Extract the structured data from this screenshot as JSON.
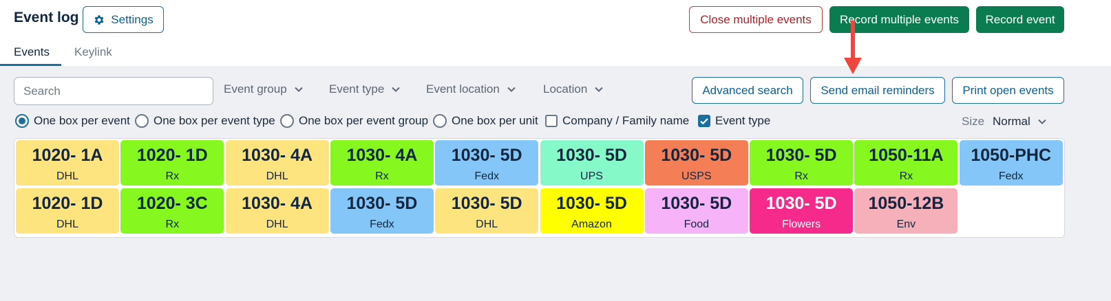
{
  "header": {
    "title": "Event log",
    "settings_label": "Settings",
    "close_multiple_label": "Close multiple events",
    "record_multiple_label": "Record multiple events",
    "record_event_label": "Record event"
  },
  "tabs": [
    {
      "label": "Events",
      "active": true
    },
    {
      "label": "Keylink",
      "active": false
    }
  ],
  "filters": {
    "search_placeholder": "Search",
    "event_group": "Event group",
    "event_type": "Event type",
    "event_location": "Event location",
    "location": "Location",
    "advanced_search": "Advanced search",
    "send_email_reminders": "Send email reminders",
    "print_open_events": "Print open events"
  },
  "view_options": [
    {
      "label": "One box per event",
      "type": "radio",
      "checked": true
    },
    {
      "label": "One box per event type",
      "type": "radio",
      "checked": false
    },
    {
      "label": "One box per event group",
      "type": "radio",
      "checked": false
    },
    {
      "label": "One box per unit",
      "type": "radio",
      "checked": false
    },
    {
      "label": "Company / Family name",
      "type": "checkbox",
      "checked": false
    },
    {
      "label": "Event type",
      "type": "checkbox",
      "checked": true
    }
  ],
  "size": {
    "label": "Size",
    "value": "Normal"
  },
  "tiles": [
    {
      "unit": "1020- 1A",
      "type": "DHL",
      "color": "#fde47f"
    },
    {
      "unit": "1020- 1D",
      "type": "Rx",
      "color": "#86f71f"
    },
    {
      "unit": "1030- 4A",
      "type": "DHL",
      "color": "#fde47f"
    },
    {
      "unit": "1030- 4A",
      "type": "Rx",
      "color": "#86f71f"
    },
    {
      "unit": "1030- 5D",
      "type": "Fedx",
      "color": "#84c6f7"
    },
    {
      "unit": "1030- 5D",
      "type": "UPS",
      "color": "#86f9c9"
    },
    {
      "unit": "1030- 5D",
      "type": "USPS",
      "color": "#f47f56"
    },
    {
      "unit": "1030- 5D",
      "type": "Rx",
      "color": "#86f71f"
    },
    {
      "unit": "1050-11A",
      "type": "Rx",
      "color": "#86f71f"
    },
    {
      "unit": "1050-PHC",
      "type": "Fedx",
      "color": "#84c6f7"
    },
    {
      "unit": "1020- 1D",
      "type": "DHL",
      "color": "#fde47f"
    },
    {
      "unit": "1020- 3C",
      "type": "Rx",
      "color": "#86f71f"
    },
    {
      "unit": "1030- 4A",
      "type": "DHL",
      "color": "#fde47f"
    },
    {
      "unit": "1030- 5D",
      "type": "Fedx",
      "color": "#84c6f7"
    },
    {
      "unit": "1030- 5D",
      "type": "DHL",
      "color": "#fde47f"
    },
    {
      "unit": "1030- 5D",
      "type": "Amazon",
      "color": "#ffff00"
    },
    {
      "unit": "1030- 5D",
      "type": "Food",
      "color": "#f7b3f7"
    },
    {
      "unit": "1030- 5D",
      "type": "Flowers",
      "color": "#f52a8a",
      "light_text": true
    },
    {
      "unit": "1050-12B",
      "type": "Env",
      "color": "#f5b0ba"
    }
  ],
  "colors": {
    "accent": "#1a6ea0",
    "primary_green": "#0b7c50",
    "danger": "#b01e23",
    "annotation_arrow": "#f0443f"
  }
}
